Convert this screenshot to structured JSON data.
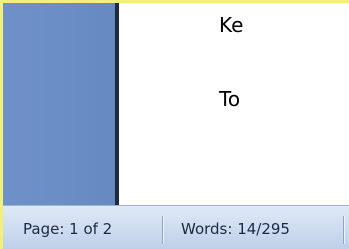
{
  "document": {
    "line_1": "Ke",
    "line_2": "To"
  },
  "statusbar": {
    "page_label": "Page: 1 of 2",
    "words_label": "Words: 14/295"
  }
}
